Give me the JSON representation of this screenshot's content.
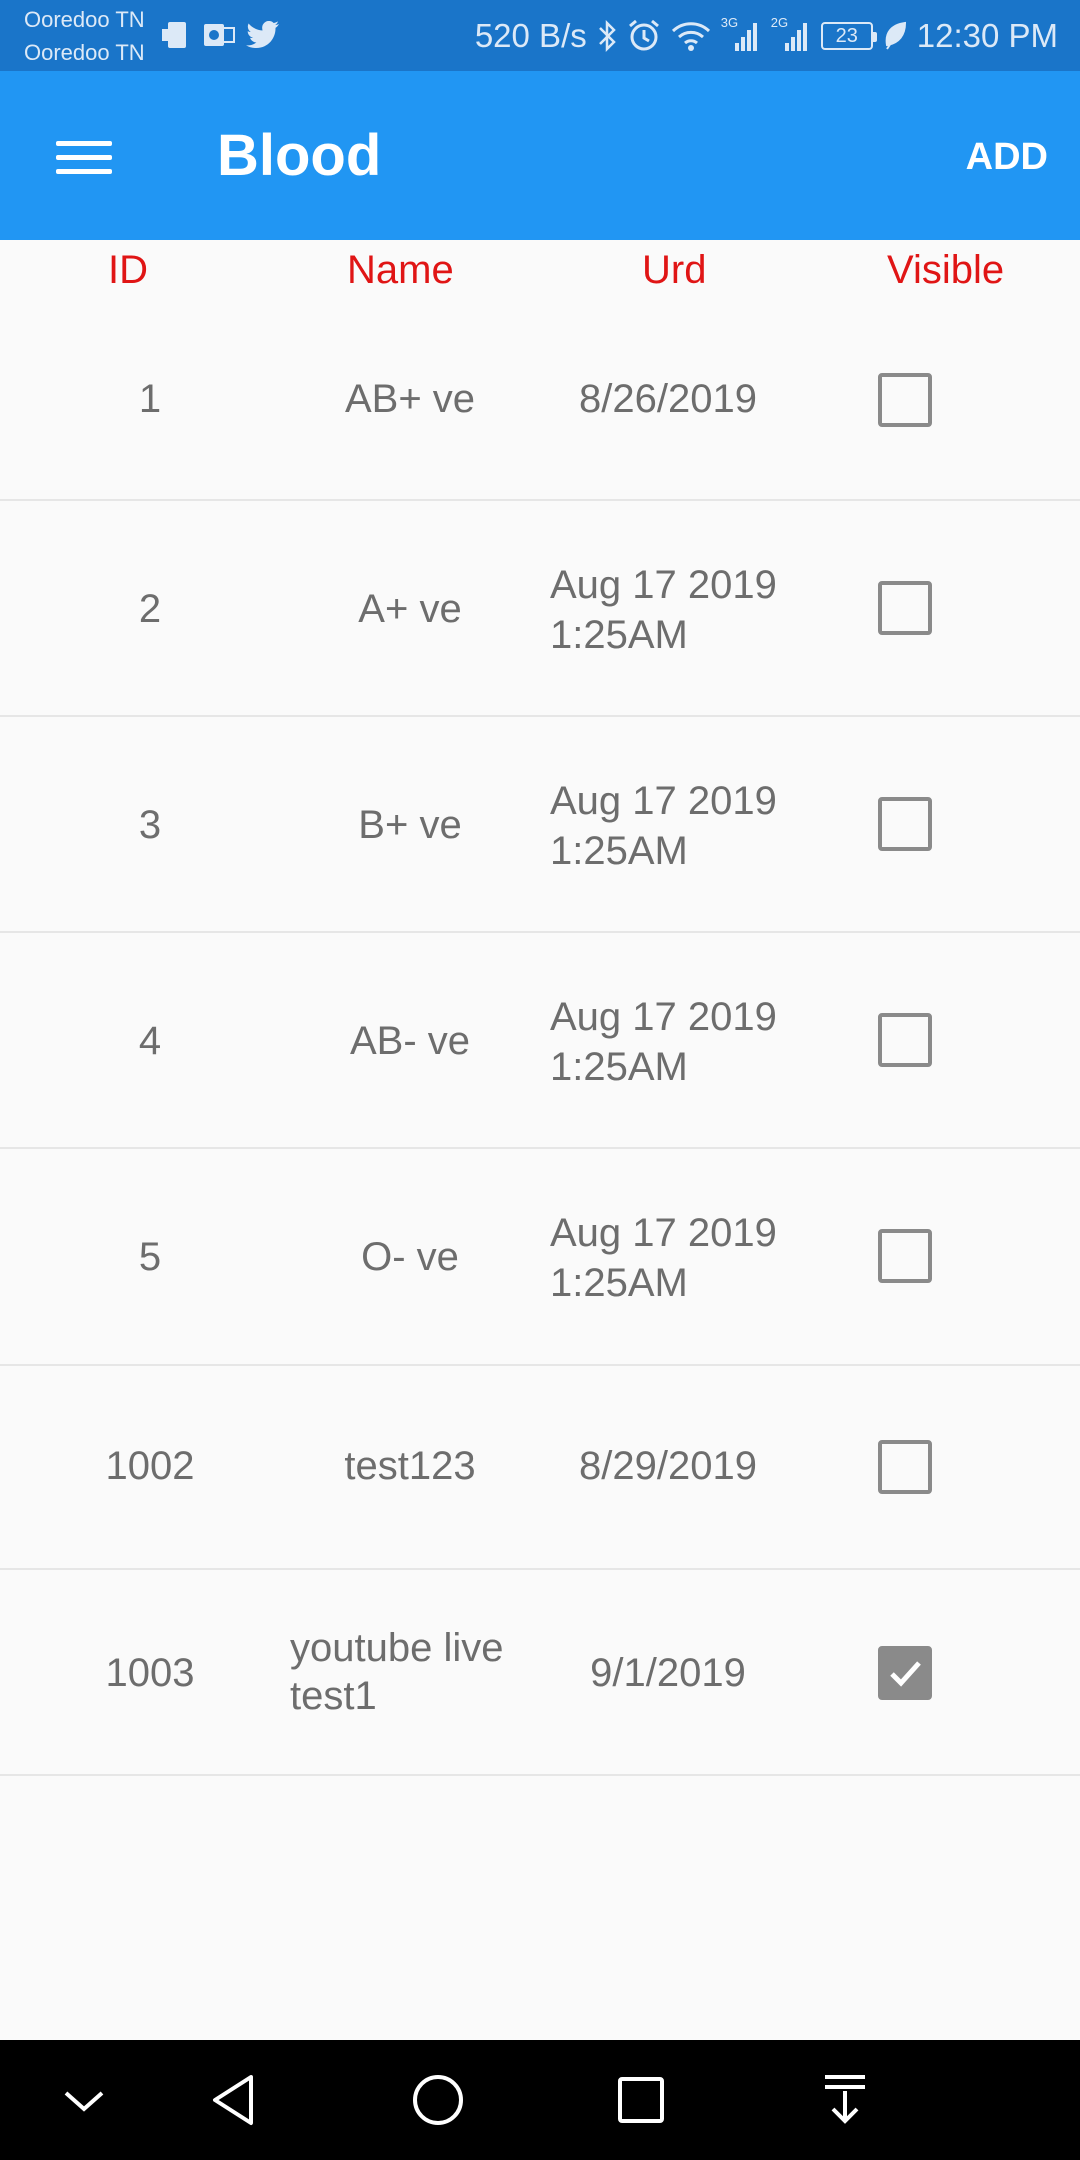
{
  "status_bar": {
    "carrier_1": "Ooredoo TN",
    "carrier_2": "Ooredoo TN",
    "speed": "520 B/s",
    "battery": "23",
    "time": "12:30 PM",
    "net_3g": "3G",
    "net_2g": "2G"
  },
  "app_bar": {
    "title": "Blood",
    "add_label": "ADD"
  },
  "table": {
    "headers": {
      "id": "ID",
      "name": "Name",
      "urd": "Urd",
      "visible": "Visible"
    },
    "rows": [
      {
        "id": "1",
        "name": "AB+ ve",
        "urd": "8/26/2019",
        "visible": false
      },
      {
        "id": "2",
        "name": "A+ ve",
        "urd_1": "Aug 17 2019",
        "urd_2": "1:25AM",
        "visible": false
      },
      {
        "id": "3",
        "name": "B+ ve",
        "urd_1": "Aug 17 2019",
        "urd_2": "1:25AM",
        "visible": false
      },
      {
        "id": "4",
        "name": "AB- ve",
        "urd_1": "Aug 17 2019",
        "urd_2": "1:25AM",
        "visible": false
      },
      {
        "id": "5",
        "name": "O- ve",
        "urd_1": "Aug 17 2019",
        "urd_2": "1:25AM",
        "visible": false
      },
      {
        "id": "1002",
        "name": "test123",
        "urd": "8/29/2019",
        "visible": false
      },
      {
        "id": "1003",
        "name_1": "youtube live",
        "name_2": "test1",
        "urd": "9/1/2019",
        "visible": true
      }
    ]
  },
  "colors": {
    "status_bar": "#1a75c9",
    "app_bar": "#2196f3",
    "header_text": "#e01515",
    "cell_text": "#6d6d6d"
  },
  "icons": {
    "status_left": [
      "sim-card-icon",
      "outlook-icon",
      "twitter-icon"
    ],
    "status_right": [
      "bluetooth-icon",
      "alarm-icon",
      "wifi-icon",
      "signal-3g-icon",
      "signal-2g-icon",
      "battery-icon",
      "leaf-icon"
    ],
    "nav": [
      "chevron-down-icon",
      "back-icon",
      "home-icon",
      "recents-icon",
      "download-icon"
    ]
  }
}
